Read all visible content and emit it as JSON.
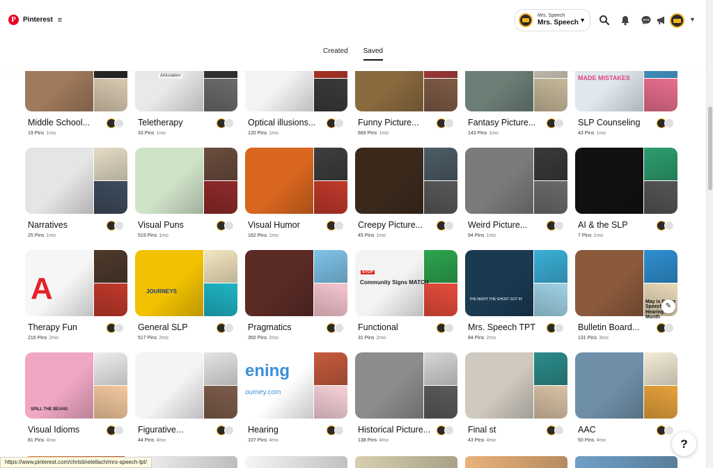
{
  "header": {
    "brand": "Pinterest",
    "menu_icon": "menu-icon",
    "account": {
      "small_label": "Mrs. Speech",
      "name": "Mrs. Speech"
    },
    "icons": [
      "search-icon",
      "bell-icon",
      "messages-icon",
      "megaphone-icon"
    ]
  },
  "tabs": [
    {
      "label": "Created",
      "active": false
    },
    {
      "label": "Saved",
      "active": true
    }
  ],
  "boards": [
    {
      "title": "Middle School...",
      "pins": "19 Pins",
      "time": "1mo",
      "colors": [
        "#a07a5c",
        "#2b2b2b",
        "#d9c9b0"
      ]
    },
    {
      "title": "Teletherapy",
      "pins": "33 Pins",
      "time": "1mo",
      "colors": [
        "#e9e9e9",
        "#3a3a3a",
        "#6b6b6b"
      ]
    },
    {
      "title": "Optical illusions...",
      "pins": "120 Pins",
      "time": "1mo",
      "colors": [
        "#f4f4f4",
        "#c0392b",
        "#3a3a3a"
      ]
    },
    {
      "title": "Funny Picture...",
      "pins": "669 Pins",
      "time": "1mo",
      "colors": [
        "#8a6a3f",
        "#b0413e",
        "#7e5b45"
      ]
    },
    {
      "title": "Fantasy Picture...",
      "pins": "143 Pins",
      "time": "1mo",
      "colors": [
        "#6c7f76",
        "#d9d2c3",
        "#c7b89a"
      ]
    },
    {
      "title": "SLP Counseling",
      "pins": "43 Pins",
      "time": "1mo",
      "colors": [
        "#dfe8ee",
        "#4aa3d8",
        "#e86e8c"
      ]
    },
    {
      "title": "Narratives",
      "pins": "25 Pins",
      "time": "1mo",
      "colors": [
        "#e5e5e5",
        "#e6dcc7",
        "#3d4b5c"
      ]
    },
    {
      "title": "Visual Puns",
      "pins": "519 Pins",
      "time": "1mo",
      "colors": [
        "#cfe3c8",
        "#6b4d3e",
        "#8e2a2a"
      ]
    },
    {
      "title": "Visual Humor",
      "pins": "162 Pins",
      "time": "1mo",
      "colors": [
        "#d9661f",
        "#3e3e3e",
        "#c0392b"
      ]
    },
    {
      "title": "Creepy Picture...",
      "pins": "45 Pins",
      "time": "1mo",
      "colors": [
        "#3b2a1c",
        "#4d5c66",
        "#585858"
      ]
    },
    {
      "title": "Weird Picture...",
      "pins": "94 Pins",
      "time": "1mo",
      "colors": [
        "#7a7a7a",
        "#3a3a3a",
        "#6a6a6a"
      ]
    },
    {
      "title": "AI & the SLP",
      "pins": "7 Pins",
      "time": "1mo",
      "colors": [
        "#111111",
        "#2e9e6f",
        "#555555"
      ]
    },
    {
      "title": "Therapy Fun",
      "pins": "216 Pins",
      "time": "2mo",
      "colors": [
        "#f6f6f6",
        "#4d3a2b",
        "#c0392b"
      ]
    },
    {
      "title": "General SLP",
      "pins": "517 Pins",
      "time": "2mo",
      "colors": [
        "#f2c100",
        "#f4e6c0",
        "#1fb4c4"
      ]
    },
    {
      "title": "Pragmatics",
      "pins": "350 Pins",
      "time": "2mo",
      "colors": [
        "#5a2a25",
        "#7fc3e8",
        "#f7c6d0"
      ]
    },
    {
      "title": "Functional",
      "pins": "31 Pins",
      "time": "2mo",
      "colors": [
        "#f3f3f3",
        "#2ea44f",
        "#e74c3c"
      ]
    },
    {
      "title": "Mrs. Speech TPT",
      "pins": "84 Pins",
      "time": "2mo",
      "colors": [
        "#1a3a52",
        "#3bb0d8",
        "#9fd2e6"
      ]
    },
    {
      "title": "Bulletin Board...",
      "pins": "131 Pins",
      "time": "3mo",
      "colors": [
        "#8b5a3c",
        "#2f8fd1",
        "#e8d9b8"
      ]
    },
    {
      "title": "Visual Idioms",
      "pins": "81 Pins",
      "time": "4mo",
      "colors": [
        "#f0a7c4",
        "#eeeeee",
        "#f4c89e"
      ]
    },
    {
      "title": "Figurative...",
      "pins": "44 Pins",
      "time": "4mo",
      "colors": [
        "#f4f4f4",
        "#e4e4e4",
        "#7d5c4a"
      ]
    },
    {
      "title": "Hearing",
      "pins": "107 Pins",
      "time": "4mo",
      "colors": [
        "#ffffff",
        "#c65b3e",
        "#f7d1da"
      ]
    },
    {
      "title": "Historical Picture...",
      "pins": "138 Pins",
      "time": "4mo",
      "colors": [
        "#8c8c8c",
        "#d6d6d6",
        "#5a5a5a"
      ]
    },
    {
      "title": "Final st",
      "pins": "43 Pins",
      "time": "4mo",
      "colors": [
        "#cfc9bf",
        "#2c8c8a",
        "#d9c2a5"
      ]
    },
    {
      "title": "AAC",
      "pins": "50 Pins",
      "time": "4mo",
      "colors": [
        "#6f8fa8",
        "#f2ecd8",
        "#e7a23b"
      ]
    }
  ],
  "cover_labels": {
    "teletherapy_caption": "Articulation",
    "therapy_fun_text": "A",
    "general_slp_text": "JOURNEYS",
    "functional_title": "Community Signs MATCH",
    "functional_stop": "STOP",
    "mrs_speech_tpt_caption": "THE NIGHT THE GHOST GOT IN",
    "slp_counseling_text": "MADE MISTAKES",
    "visual_idioms_caption": "SPILL THE BEANS",
    "hearing_text": "ening",
    "hearing_sub": "ourney.com",
    "bulletin_side": "May is Better Speech and Hearing Month"
  },
  "status_url": "https://www.pinterest.com/christinetellach/mrs-speech-tpt/",
  "help_label": "?",
  "edit_icon": "pencil-icon"
}
